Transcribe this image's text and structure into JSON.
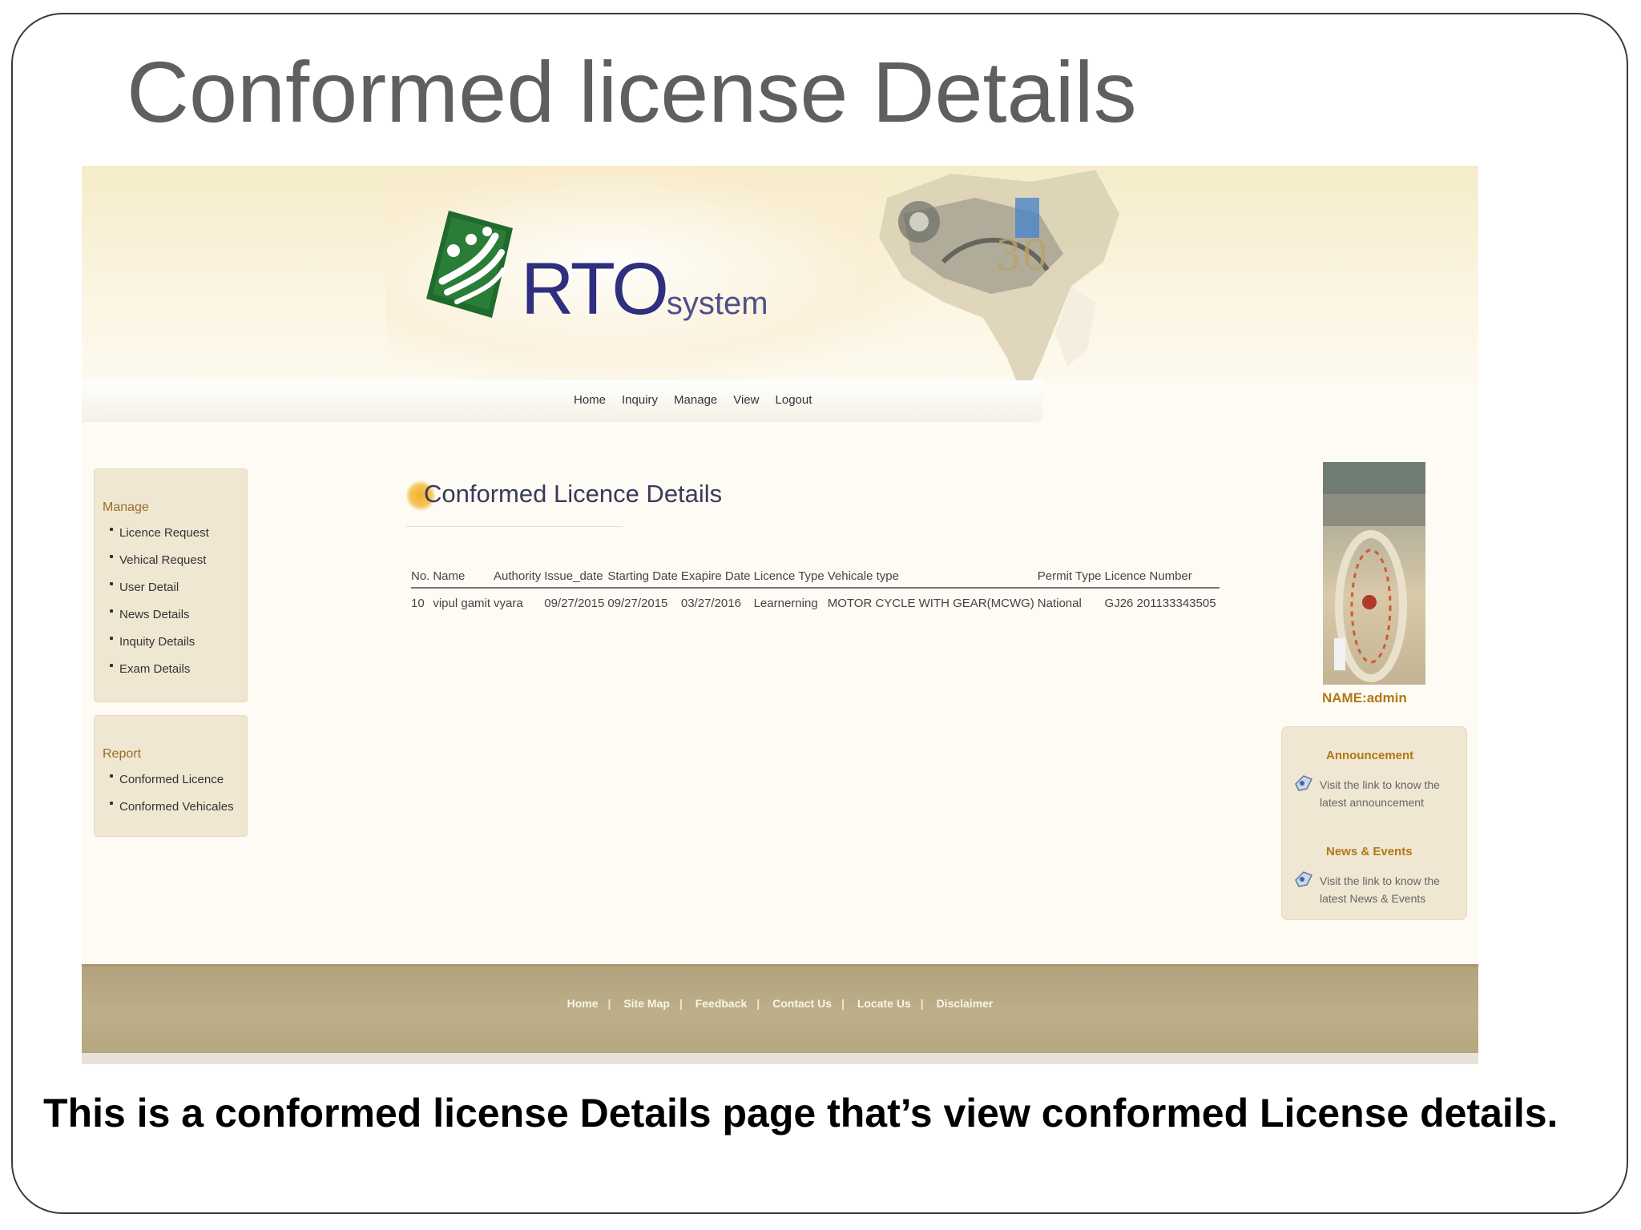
{
  "slide": {
    "title": "Conformed license Details",
    "caption": "This is a conformed license Details page that’s view conformed License details."
  },
  "logo": {
    "main": "RTO",
    "sub": "system"
  },
  "nav": [
    "Home",
    "Inquiry",
    "Manage",
    "View",
    "Logout"
  ],
  "manage_box": {
    "title": "Manage",
    "items": [
      "Licence Request",
      "Vehical Request",
      "User Detail",
      "News Details",
      "Inquity Details",
      "Exam Details"
    ]
  },
  "report_box": {
    "title": "Report",
    "items": [
      "Conformed Licence",
      "Conformed Vehicales"
    ]
  },
  "content": {
    "title": "Conformed Licence Details",
    "columns": [
      "No.",
      "Name",
      "Authority",
      "Issue_date",
      "Starting Date",
      "Exapire Date",
      "Licence Type",
      "Vehicale type",
      "Permit Type",
      "Licence Number"
    ],
    "rows": [
      [
        "10",
        "vipul gamit",
        "vyara",
        "09/27/2015",
        "09/27/2015",
        "03/27/2016",
        "Learnerning",
        "MOTOR CYCLE WITH GEAR(MCWG)",
        "National",
        "GJ26 201133343505"
      ]
    ]
  },
  "user": {
    "name_label": "NAME:admin"
  },
  "sidebar_right": {
    "announcement_title": "Announcement",
    "announcement_text": "Visit the link to know the latest announcement",
    "news_title": "News & Events",
    "news_text": "Visit the link to know the latest News & Events"
  },
  "footer": {
    "links": [
      "Home",
      "Site Map",
      "Feedback",
      "Contact Us",
      "Locate Us",
      "Disclaimer"
    ],
    "separator": "|"
  },
  "colors": {
    "accent": "#b07814",
    "footer": "#b8a983",
    "logo_green": "#1e6b2e",
    "logo_blue": "#2f2f7f"
  }
}
